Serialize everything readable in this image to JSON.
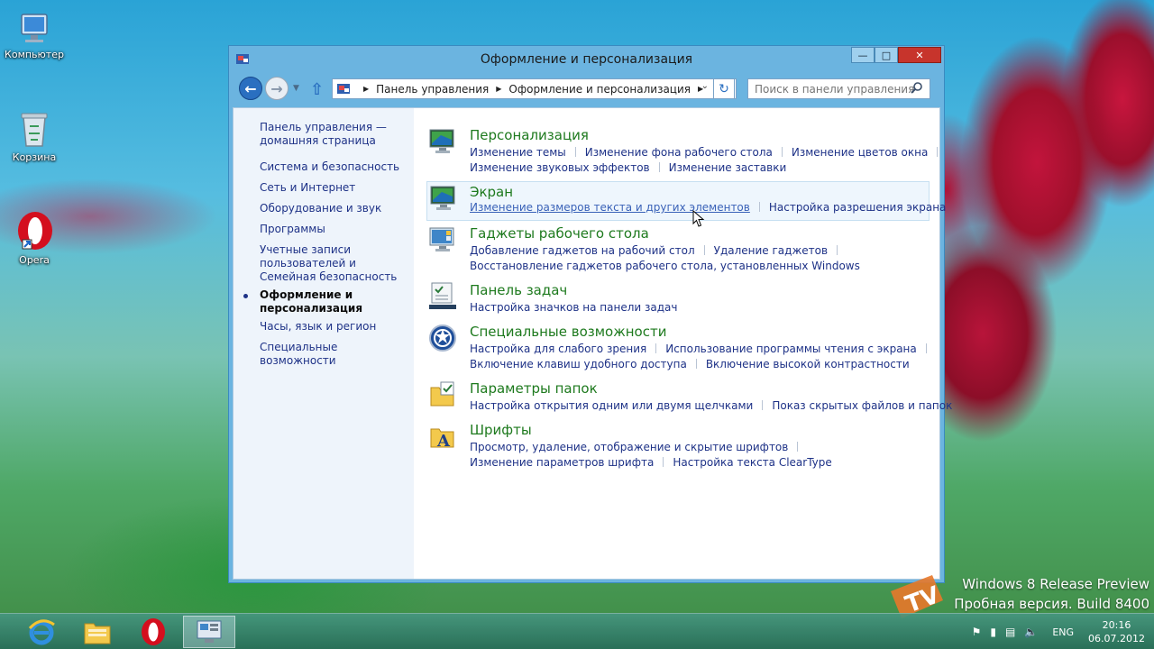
{
  "desktop": {
    "icons": [
      {
        "label": "Компьютер"
      },
      {
        "label": "Корзина"
      },
      {
        "label": "Opera"
      }
    ]
  },
  "window": {
    "title": "Оформление и персонализация",
    "breadcrumb": [
      "Панель управления",
      "Оформление и персонализация"
    ],
    "search_placeholder": "Поиск в панели управления"
  },
  "sidebar": {
    "items": [
      "Панель управления — домашняя страница",
      "Система и безопасность",
      "Сеть и Интернет",
      "Оборудование и звук",
      "Программы",
      "Учетные записи пользователей и Семейная безопасность",
      "Оформление и персонализация",
      "Часы, язык и регион",
      "Специальные возможности"
    ],
    "active_index": 6
  },
  "categories": [
    {
      "title": "Персонализация",
      "icon": "personalization-icon",
      "rows": [
        [
          "Изменение темы",
          "Изменение фона рабочего стола",
          "Изменение цветов окна"
        ],
        [
          "Изменение звуковых эффектов",
          "Изменение заставки"
        ]
      ]
    },
    {
      "title": "Экран",
      "icon": "display-icon",
      "rows": [
        [
          "Изменение размеров текста и других элементов",
          "Настройка разрешения экрана"
        ]
      ]
    },
    {
      "title": "Гаджеты рабочего стола",
      "icon": "gadgets-icon",
      "rows": [
        [
          "Добавление гаджетов на рабочий стол",
          "Удаление гаджетов"
        ],
        [
          "Восстановление гаджетов рабочего стола, установленных Windows"
        ]
      ]
    },
    {
      "title": "Панель задач",
      "icon": "taskbar-icon",
      "rows": [
        [
          "Настройка значков на панели задач"
        ]
      ]
    },
    {
      "title": "Специальные возможности",
      "icon": "accessibility-icon",
      "rows": [
        [
          "Настройка для слабого зрения",
          "Использование программы чтения с экрана"
        ],
        [
          "Включение клавиш удобного доступа",
          "Включение высокой контрастности"
        ]
      ]
    },
    {
      "title": "Параметры папок",
      "icon": "folder-options-icon",
      "rows": [
        [
          "Настройка открытия одним или двумя щелчками",
          "Показ скрытых файлов и папок"
        ]
      ]
    },
    {
      "title": "Шрифты",
      "icon": "fonts-icon",
      "rows": [
        [
          "Просмотр, удаление, отображение и скрытие шрифтов"
        ],
        [
          "Изменение параметров шрифта",
          "Настройка текста ClearType"
        ]
      ]
    }
  ],
  "taskbar": {
    "language": "ENG",
    "time": "20:16",
    "date": "06.07.2012"
  },
  "watermark": {
    "line1": "Windows 8 Release Preview",
    "line2": "Пробная версия. Build 8400"
  }
}
